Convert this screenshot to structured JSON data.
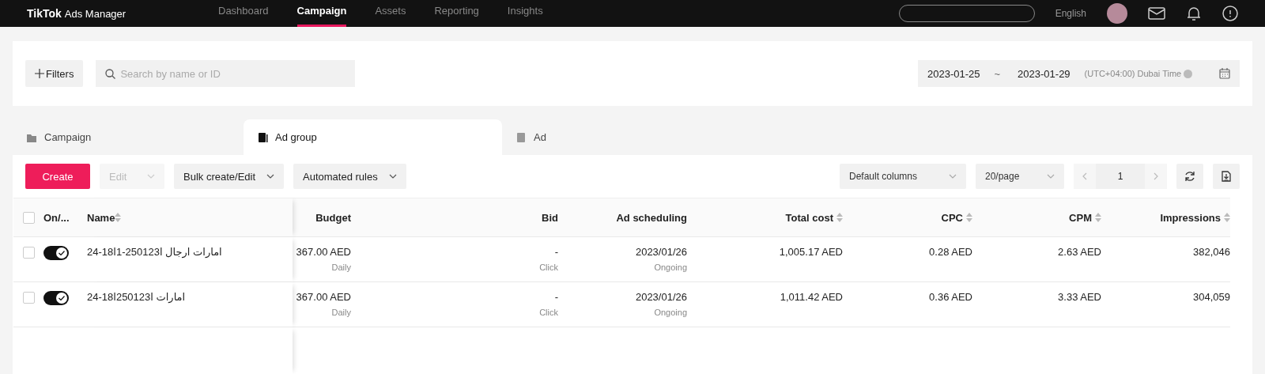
{
  "header": {
    "logo": "TikTok",
    "product": "Ads Manager",
    "nav": [
      {
        "label": "Dashboard",
        "selected": false
      },
      {
        "label": "Campaign",
        "selected": true
      },
      {
        "label": "Assets",
        "selected": false
      },
      {
        "label": "Reporting",
        "selected": false
      },
      {
        "label": "Insights",
        "selected": false
      }
    ],
    "language": "English"
  },
  "filter_bar": {
    "filters_button": "Filters",
    "search": {
      "placeholder": "Search by name or ID"
    },
    "date_range": {
      "start": "2023-01-25",
      "separator": "~",
      "end": "2023-01-29",
      "timezone": "(UTC+04:00) Dubai Time"
    }
  },
  "level_tabs": [
    {
      "label": "Campaign",
      "kind": "folder",
      "selected": false
    },
    {
      "label": "Ad group",
      "kind": "adgroup",
      "selected": true
    },
    {
      "label": "Ad",
      "kind": "ad",
      "selected": false
    }
  ],
  "toolbar": {
    "actions": [
      {
        "label": "Create",
        "kind": "primary",
        "disabled": false
      },
      {
        "label": "Edit",
        "kind": "dropdown",
        "disabled": true
      },
      {
        "label": "Bulk create/Edit",
        "kind": "dropdown",
        "disabled": false
      },
      {
        "label": "Automated rules",
        "kind": "dropdown",
        "disabled": false
      }
    ],
    "columns_select": "Default columns",
    "page_size": "20/page",
    "page": "1"
  },
  "table": {
    "select_all_checked": false,
    "columns": [
      {
        "label": "On/...",
        "sortable": false
      },
      {
        "label": "Name",
        "sortable": true
      },
      {
        "label": "Budget",
        "sortable": false
      },
      {
        "label": "Bid",
        "sortable": false
      },
      {
        "label": "Ad scheduling",
        "sortable": false
      },
      {
        "label": "Total cost",
        "sortable": true
      },
      {
        "label": "CPC",
        "sortable": true
      },
      {
        "label": "CPM",
        "sortable": true
      },
      {
        "label": "Impressions",
        "sortable": true
      }
    ],
    "rows": [
      {
        "checked": false,
        "on": true,
        "name": "امارات ارجال ا250123-1ا18-24",
        "budget": "367.00 AED",
        "budget_type": "Daily",
        "bid": "-",
        "bid_type": "Click",
        "schedule": "2023/01/26",
        "schedule_status": "Ongoing",
        "total_cost": "1,005.17 AED",
        "cpc": "0.28 AED",
        "cpm": "2.63 AED",
        "impressions": "382,046"
      },
      {
        "checked": false,
        "on": true,
        "name": "امارات ا250123ا18-24",
        "budget": "367.00 AED",
        "budget_type": "Daily",
        "bid": "-",
        "bid_type": "Click",
        "schedule": "2023/01/26",
        "schedule_status": "Ongoing",
        "total_cost": "1,011.42 AED",
        "cpc": "0.36 AED",
        "cpm": "3.33 AED",
        "impressions": "304,059"
      }
    ]
  }
}
